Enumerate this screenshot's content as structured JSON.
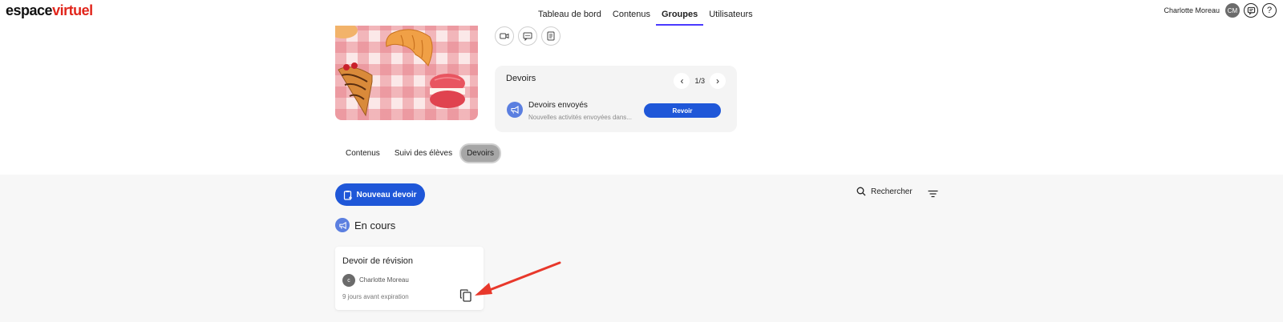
{
  "header": {
    "logo_part1": "espace",
    "logo_part2": "virtuel",
    "nav": [
      {
        "label": "Tableau de bord",
        "active": false
      },
      {
        "label": "Contenus",
        "active": false
      },
      {
        "label": "Groupes",
        "active": true
      },
      {
        "label": "Utilisateurs",
        "active": false
      }
    ],
    "user_name": "Charlotte Moreau",
    "user_initials": "CM",
    "help_glyph": "?"
  },
  "widget": {
    "title": "Devoirs",
    "pager": "1/3",
    "item_label": "Devoirs envoyés",
    "item_sub": "Nouvelles activités envoyées dans...",
    "button": "Revoir"
  },
  "subtabs": [
    {
      "label": "Contenus",
      "active": false
    },
    {
      "label": "Suivi des élèves",
      "active": false
    },
    {
      "label": "Devoirs",
      "active": true
    }
  ],
  "toolbar": {
    "new_button": "Nouveau devoir",
    "search_label": "Rechercher"
  },
  "section": {
    "title": "En cours"
  },
  "card": {
    "title": "Devoir de révision",
    "author_initial": "c",
    "author": "Charlotte Moreau",
    "expiration": "9 jours avant expiration"
  },
  "colors": {
    "accent_blue": "#1f57d8",
    "nav_underline": "#4a3aff",
    "logo_red": "#e1251b",
    "annotation_arrow": "#e8382b"
  }
}
